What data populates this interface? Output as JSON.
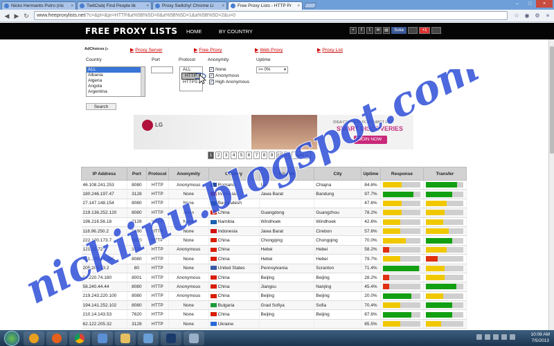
{
  "tabs": [
    {
      "title": "Nicko Hermanto Putro (nic",
      "close": "×",
      "active": false
    },
    {
      "title": "TwitClub| Find People lik",
      "close": "×",
      "active": false
    },
    {
      "title": "Proxy Switchy! Chrome Li",
      "close": "×",
      "active": false
    },
    {
      "title": "Free Proxy Lists - HTTP Pr",
      "close": "×",
      "active": true
    }
  ],
  "url": {
    "domain": "www.freeproxylists.net",
    "path": "/?c=&pt=&pr=HTTP&a%5B%5D=0&a%5B%5D=1&a%5B%5D=2&u=0"
  },
  "site": {
    "logo": "FREE PROXY LISTS",
    "nav_home": "HOME",
    "nav_country": "BY COUNTRY",
    "share_fb": "Suka",
    "share_g": "+1"
  },
  "filters": {
    "adchoices": "AdChoices ▷",
    "links": [
      "Proxy Server",
      "Free Proxy",
      "Web Proxy",
      "Proxy List"
    ],
    "country_label": "Country",
    "port_label": "Port",
    "protocol_label": "Protocol",
    "anonymity_label": "Anonymity",
    "uptime_label": "Uptime",
    "countries": [
      "ALL",
      "Albania",
      "Algeria",
      "Angola",
      "Argentina"
    ],
    "protocols": [
      "ALL",
      "HTTP",
      "HTTPS"
    ],
    "anonymity": [
      "None",
      "Anonymous",
      "High Anonymous"
    ],
    "uptime_value": ">= 0%",
    "search": "Search"
  },
  "banner": {
    "brand": "LG",
    "idea": "IDEA CONTEST FOR SMART LIFE",
    "headline": "SMART DISCOVERIES",
    "cta": "JOIN NOW"
  },
  "pager": [
    "1",
    "2",
    "3",
    "4",
    "5",
    "6",
    "7",
    "8",
    "9",
    "10",
    "11",
    "Next »"
  ],
  "columns": [
    "IP Address",
    "Port",
    "Protocol",
    "Anonymity",
    "Country",
    "Region",
    "City",
    "Uptime",
    "Response",
    "Transfer"
  ],
  "rows": [
    {
      "ip": "46.108.241.253",
      "port": "8080",
      "proto": "HTTP",
      "anon": "Anonymous",
      "country": "Romania",
      "region": "Iasi",
      "city": "Chiajna",
      "uptime": "84.6%",
      "resp": 0.5,
      "resp_color": "#f0c800",
      "xfer": 0.82,
      "xfer_color": "#12a012"
    },
    {
      "ip": "180.246.197.47",
      "port": "3128",
      "proto": "HTTP",
      "anon": "None",
      "country": "Indonesia",
      "region": "Jawa Barat",
      "city": "Bandung",
      "uptime": "97.7%",
      "resp": 0.8,
      "resp_color": "#12a012",
      "xfer": 0.7,
      "xfer_color": "#12a012"
    },
    {
      "ip": "27.147.148.154",
      "port": "8080",
      "proto": "HTTP",
      "anon": "None",
      "country": "Bangladesh",
      "region": "",
      "city": "",
      "uptime": "47.6%",
      "resp": 0.5,
      "resp_color": "#f0c800",
      "xfer": 0.55,
      "xfer_color": "#f0c800"
    },
    {
      "ip": "219.136.252.120",
      "port": "8080",
      "proto": "HTTP",
      "anon": "None",
      "country": "China",
      "region": "Guangdong",
      "city": "Guangzhou",
      "uptime": "78.2%",
      "resp": 0.5,
      "resp_color": "#f0c800",
      "xfer": 0.5,
      "xfer_color": "#f0c800"
    },
    {
      "ip": "196.216.56.18",
      "port": "3128",
      "proto": "HTTP",
      "anon": "None",
      "country": "Namibia",
      "region": "Windhoek",
      "city": "Windhoek",
      "uptime": "42.6%",
      "resp": 0.45,
      "resp_color": "#f0c800",
      "xfer": 0.45,
      "xfer_color": "#f0c800"
    },
    {
      "ip": "118.96.250.2",
      "port": "8080",
      "proto": "HTTP",
      "anon": "None",
      "country": "Indonesia",
      "region": "Jawa Barat",
      "city": "Cirebon",
      "uptime": "57.6%",
      "resp": 0.45,
      "resp_color": "#f0c800",
      "xfer": 0.6,
      "xfer_color": "#f0c800"
    },
    {
      "ip": "222.180.173.7",
      "port": "9000",
      "proto": "HTTP",
      "anon": "None",
      "country": "China",
      "region": "Chongqing",
      "city": "Chongqing",
      "uptime": "70.0%",
      "resp": 0.6,
      "resp_color": "#f0c800",
      "xfer": 0.7,
      "xfer_color": "#12a012"
    },
    {
      "ip": "121.22.72.5",
      "port": "3128",
      "proto": "HTTP",
      "anon": "Anonymous",
      "country": "China",
      "region": "Hebei",
      "city": "Hebei",
      "uptime": "58.2%",
      "resp": 0.15,
      "resp_color": "#e03010",
      "xfer": 0.55,
      "xfer_color": "#f0c800"
    },
    {
      "ip": "221.195.12.186",
      "port": "8080",
      "proto": "HTTP",
      "anon": "None",
      "country": "China",
      "region": "Hebei",
      "city": "Hebei",
      "uptime": "79.7%",
      "resp": 0.45,
      "resp_color": "#f0c800",
      "xfer": 0.3,
      "xfer_color": "#e03010"
    },
    {
      "ip": "205.203.79.2",
      "port": "80",
      "proto": "HTTP",
      "anon": "None",
      "country": "United States",
      "region": "Pennsylvania",
      "city": "Scranton",
      "uptime": "71.4%",
      "resp": 0.95,
      "resp_color": "#12a012",
      "xfer": 0.5,
      "xfer_color": "#f0c800"
    },
    {
      "ip": "58.220.74.180",
      "port": "8001",
      "proto": "HTTP",
      "anon": "Anonymous",
      "country": "China",
      "region": "Beijing",
      "city": "Beijing",
      "uptime": "28.2%",
      "resp": 0.15,
      "resp_color": "#e03010",
      "xfer": 0.5,
      "xfer_color": "#f0c800"
    },
    {
      "ip": "58.240.44.44",
      "port": "8080",
      "proto": "HTTP",
      "anon": "Anonymous",
      "country": "China",
      "region": "Jiangsu",
      "city": "Nanjing",
      "uptime": "45.4%",
      "resp": 0.15,
      "resp_color": "#e03010",
      "xfer": 0.8,
      "xfer_color": "#12a012"
    },
    {
      "ip": "219.243.220.100",
      "port": "8080",
      "proto": "HTTP",
      "anon": "Anonymous",
      "country": "China",
      "region": "Beijing",
      "city": "Beijing",
      "uptime": "20.0%",
      "resp": 0.75,
      "resp_color": "#12a012",
      "xfer": 0.45,
      "xfer_color": "#f0c800"
    },
    {
      "ip": "194.141.252.102",
      "port": "8080",
      "proto": "HTTP",
      "anon": "None",
      "country": "Bulgaria",
      "region": "Grad Sofiya",
      "city": "Sofia",
      "uptime": "70.4%",
      "resp": 0.45,
      "resp_color": "#f0c800",
      "xfer": 0.7,
      "xfer_color": "#12a012"
    },
    {
      "ip": "210.14.143.53",
      "port": "7620",
      "proto": "HTTP",
      "anon": "None",
      "country": "China",
      "region": "Beijing",
      "city": "Beijing",
      "uptime": "87.6%",
      "resp": 0.75,
      "resp_color": "#12a012",
      "xfer": 0.7,
      "xfer_color": "#12a012"
    },
    {
      "ip": "62.122.205.32",
      "port": "3128",
      "proto": "HTTP",
      "anon": "None",
      "country": "Ukraine",
      "region": "",
      "city": "",
      "uptime": "85.5%",
      "resp": 0.45,
      "resp_color": "#f0c800",
      "xfer": 0.4,
      "xfer_color": "#f0c800"
    }
  ],
  "flag_colors": {
    "Romania": "#2a4fa8",
    "Indonesia": "#d21010",
    "Bangladesh": "#0a6a3a",
    "China": "#d81e06",
    "Namibia": "#1b5fb0",
    "United States": "#3c5aa6",
    "Bulgaria": "#1d9a3a",
    "Ukraine": "#2a6ad8"
  },
  "watermark": "nickiinu.blogspot.com",
  "clock": {
    "time": "10:09 AM",
    "date": "7/5/2013"
  }
}
